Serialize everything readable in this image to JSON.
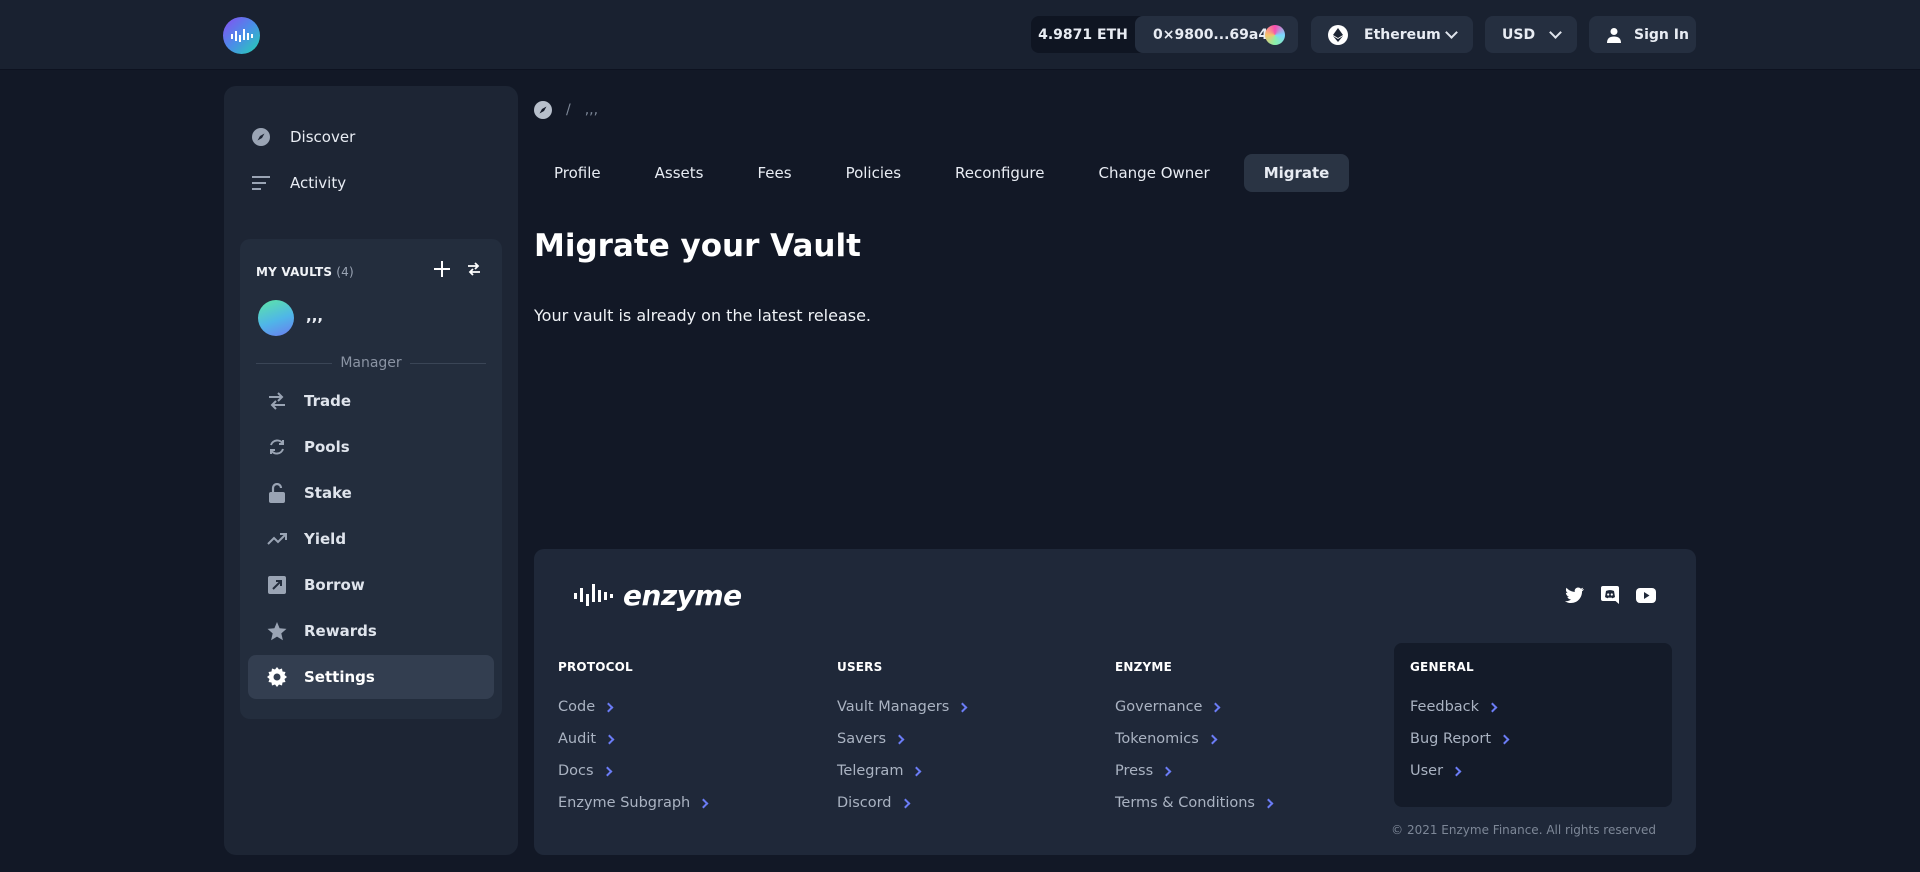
{
  "header": {
    "eth_balance": "4.9871 ETH",
    "address": "0×9800...69a4",
    "network": "Ethereum",
    "currency": "USD",
    "sign_in": "Sign In"
  },
  "sidebar": {
    "top_items": [
      {
        "label": "Discover",
        "icon": "compass-icon"
      },
      {
        "label": "Activity",
        "icon": "list-icon"
      }
    ],
    "vaults_title": "MY VAULTS",
    "vaults_count": "(4)",
    "vault_name": ",,,",
    "role_label": "Manager",
    "menu": [
      {
        "label": "Trade",
        "icon": "swap-icon"
      },
      {
        "label": "Pools",
        "icon": "refresh-icon"
      },
      {
        "label": "Stake",
        "icon": "lock-icon"
      },
      {
        "label": "Yield",
        "icon": "trending-up-icon"
      },
      {
        "label": "Borrow",
        "icon": "borrow-icon"
      },
      {
        "label": "Rewards",
        "icon": "star-icon"
      },
      {
        "label": "Settings",
        "icon": "gear-icon",
        "active": true
      }
    ]
  },
  "breadcrumb": {
    "current": ",,,"
  },
  "tabs": [
    {
      "label": "Profile"
    },
    {
      "label": "Assets"
    },
    {
      "label": "Fees"
    },
    {
      "label": "Policies"
    },
    {
      "label": "Reconfigure"
    },
    {
      "label": "Change Owner"
    },
    {
      "label": "Migrate",
      "active": true
    }
  ],
  "main": {
    "title": "Migrate your Vault",
    "message": "Your vault is already on the latest release."
  },
  "footer": {
    "logo_text": "enzyme",
    "columns": [
      {
        "title": "PROTOCOL",
        "links": [
          "Code",
          "Audit",
          "Docs",
          "Enzyme Subgraph"
        ]
      },
      {
        "title": "USERS",
        "links": [
          "Vault Managers",
          "Savers",
          "Telegram",
          "Discord"
        ]
      },
      {
        "title": "ENZYME",
        "links": [
          "Governance",
          "Tokenomics",
          "Press",
          "Terms & Conditions"
        ]
      },
      {
        "title": "GENERAL",
        "links": [
          "Feedback",
          "Bug Report",
          "User"
        ]
      }
    ],
    "copyright": "© 2021 Enzyme Finance. All rights reserved"
  },
  "colors": {
    "background": "#121826",
    "panel": "#1d2534",
    "accent_link_arrow": "#6b7cf5"
  }
}
